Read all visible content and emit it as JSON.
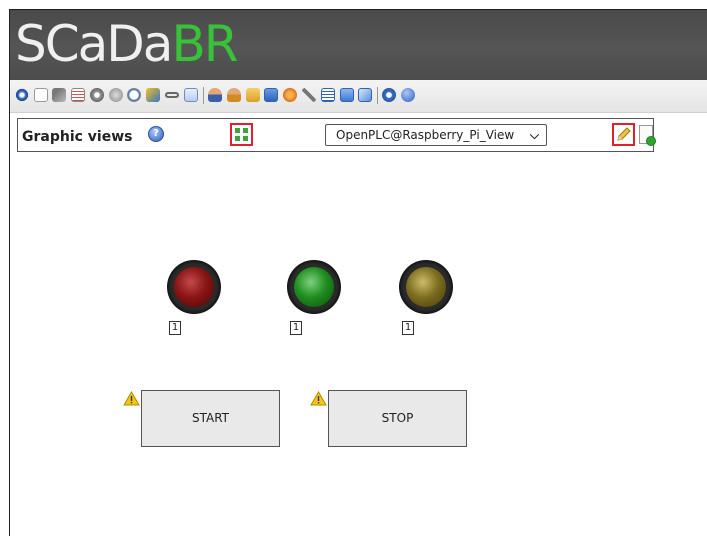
{
  "brand": {
    "logo_part1": "SCaDa",
    "logo_part2": "BR"
  },
  "toolbar": {
    "icons": [
      "watch-list-icon",
      "new-document-icon",
      "flag-icon",
      "report-icon",
      "settings-gear-icon",
      "datasource-icon",
      "clock-icon",
      "bell-icon",
      "chain-link-icon",
      "chart-icon",
      "user-icon",
      "users-icon",
      "folder-icon",
      "memo-icon",
      "radio-icon",
      "tools-icon",
      "text-editor-icon",
      "image-icon",
      "document-icon",
      "stop-icon",
      "help-icon"
    ]
  },
  "panel": {
    "title": "Graphic views",
    "help_icon": "?",
    "selected_view": "OpenPLC@Raspberry_Pi_View",
    "dropdown_icon": "chevron-down-icon",
    "edit_icon": "pencil-icon",
    "add_icon": "new-view-icon"
  },
  "view": {
    "lamps": [
      {
        "color": "#8a1515",
        "value": "1"
      },
      {
        "color": "#1f8f1f",
        "value": "1"
      },
      {
        "color": "#7e6e20",
        "value": "1"
      }
    ],
    "buttons": [
      {
        "label": "START",
        "warning_icon": "warning-icon"
      },
      {
        "label": "STOP",
        "warning_icon": "warning-icon"
      }
    ]
  },
  "colors": {
    "highlight": "#e0202a",
    "brand_green": "#38c238",
    "header_bg": "#4f4f4f"
  }
}
